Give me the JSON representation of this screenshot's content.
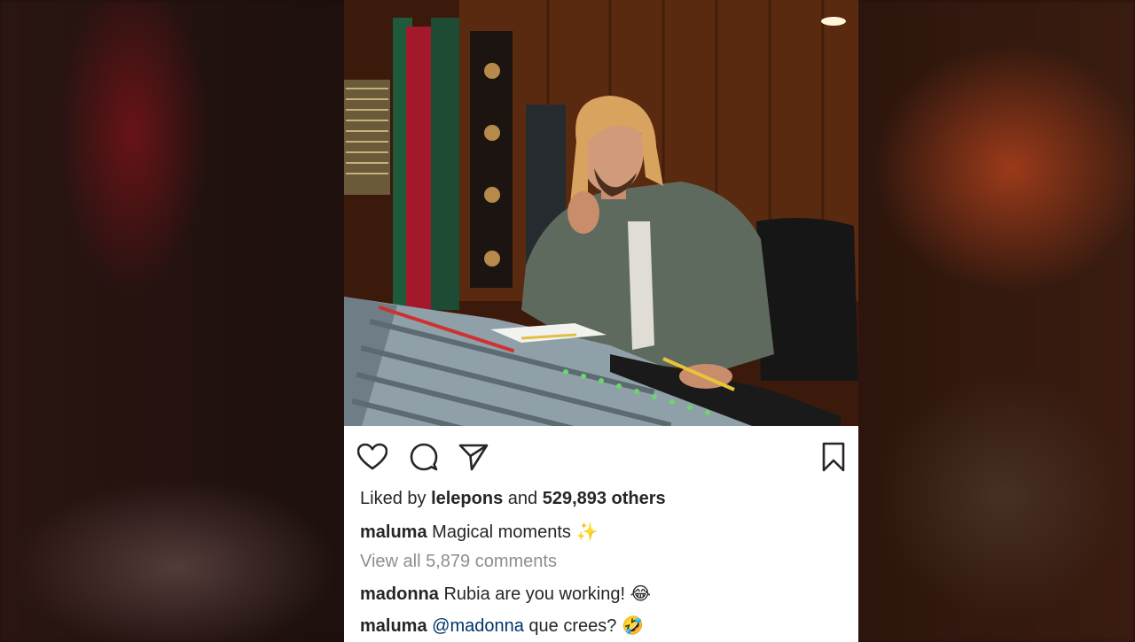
{
  "post": {
    "likes": {
      "prefix": "Liked by",
      "first_liker": "lelepons",
      "joiner": "and",
      "count_text": "529,893 others"
    },
    "caption": {
      "user": "maluma",
      "text": "Magical moments",
      "emoji": "✨"
    },
    "view_all": "View all 5,879 comments",
    "comments": [
      {
        "user": "madonna",
        "text": "Rubia are you working!",
        "emoji": "😂"
      },
      {
        "user": "maluma",
        "mention": "@madonna",
        "text": "que crees?",
        "emoji": "🤣"
      }
    ]
  },
  "icons": {
    "like": "heart-icon",
    "comment": "comment-bubble-icon",
    "share": "paper-plane-icon",
    "save": "bookmark-icon"
  },
  "colors": {
    "text": "#262626",
    "muted": "#8e8e8e",
    "mention": "#003569",
    "background": "#ffffff"
  }
}
